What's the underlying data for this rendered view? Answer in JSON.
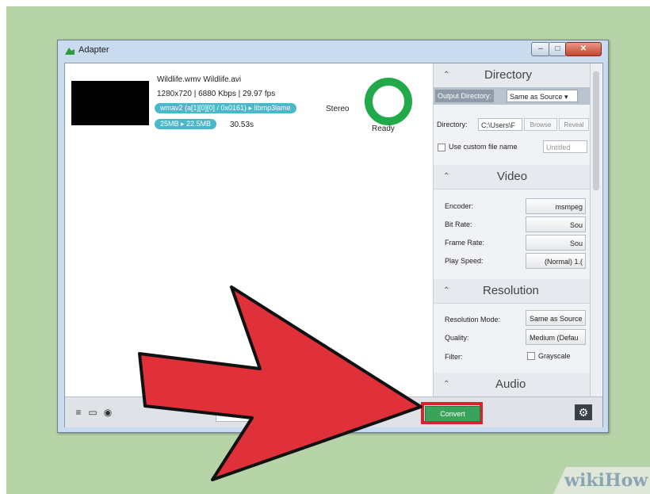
{
  "window": {
    "title": "Adapter"
  },
  "file": {
    "names": "Wildlife.wmv  Wildlife.avi",
    "meta": "1280x720  |  6880 Kbps  |  29.97 fps",
    "codec": "wmav2 (a[1][0][0] / 0x0161) ▸ libmp3lame",
    "channels": "Stereo",
    "size": "25MB ▸ 22.5MB",
    "duration": "30.53s",
    "status": "Ready"
  },
  "directory": {
    "title": "Directory",
    "output_label": "Output Directory:",
    "output_value": "Same as Source",
    "dir_label": "Directory:",
    "dir_value": "C:\\Users\\F",
    "browse": "Browse",
    "reveal": "Reveal",
    "custom_label": "Use custom file name",
    "custom_placeholder": "Untitled"
  },
  "video": {
    "title": "Video",
    "encoder_label": "Encoder:",
    "encoder_value": "msmpeg",
    "bitrate_label": "Bit Rate:",
    "bitrate_value": "Sou",
    "framerate_label": "Frame Rate:",
    "framerate_value": "Sou",
    "playspeed_label": "Play Speed:",
    "playspeed_value": "(Normal) 1.("
  },
  "resolution": {
    "title": "Resolution",
    "mode_label": "Resolution Mode:",
    "mode_value": "Same as Source",
    "quality_label": "Quality:",
    "quality_value": "Medium (Defau",
    "filter_label": "Filter:",
    "grayscale_label": "Grayscale"
  },
  "audio": {
    "title": "Audio"
  },
  "toolbar": {
    "video_tab": "Video",
    "convert": "Convert"
  },
  "watermark": "wikiHow",
  "colors": {
    "ring": "#21a94a",
    "pill": "#49b8c9",
    "convert": "#3aa35b",
    "highlight": "#d3252c",
    "arrow": "#e0303a"
  }
}
